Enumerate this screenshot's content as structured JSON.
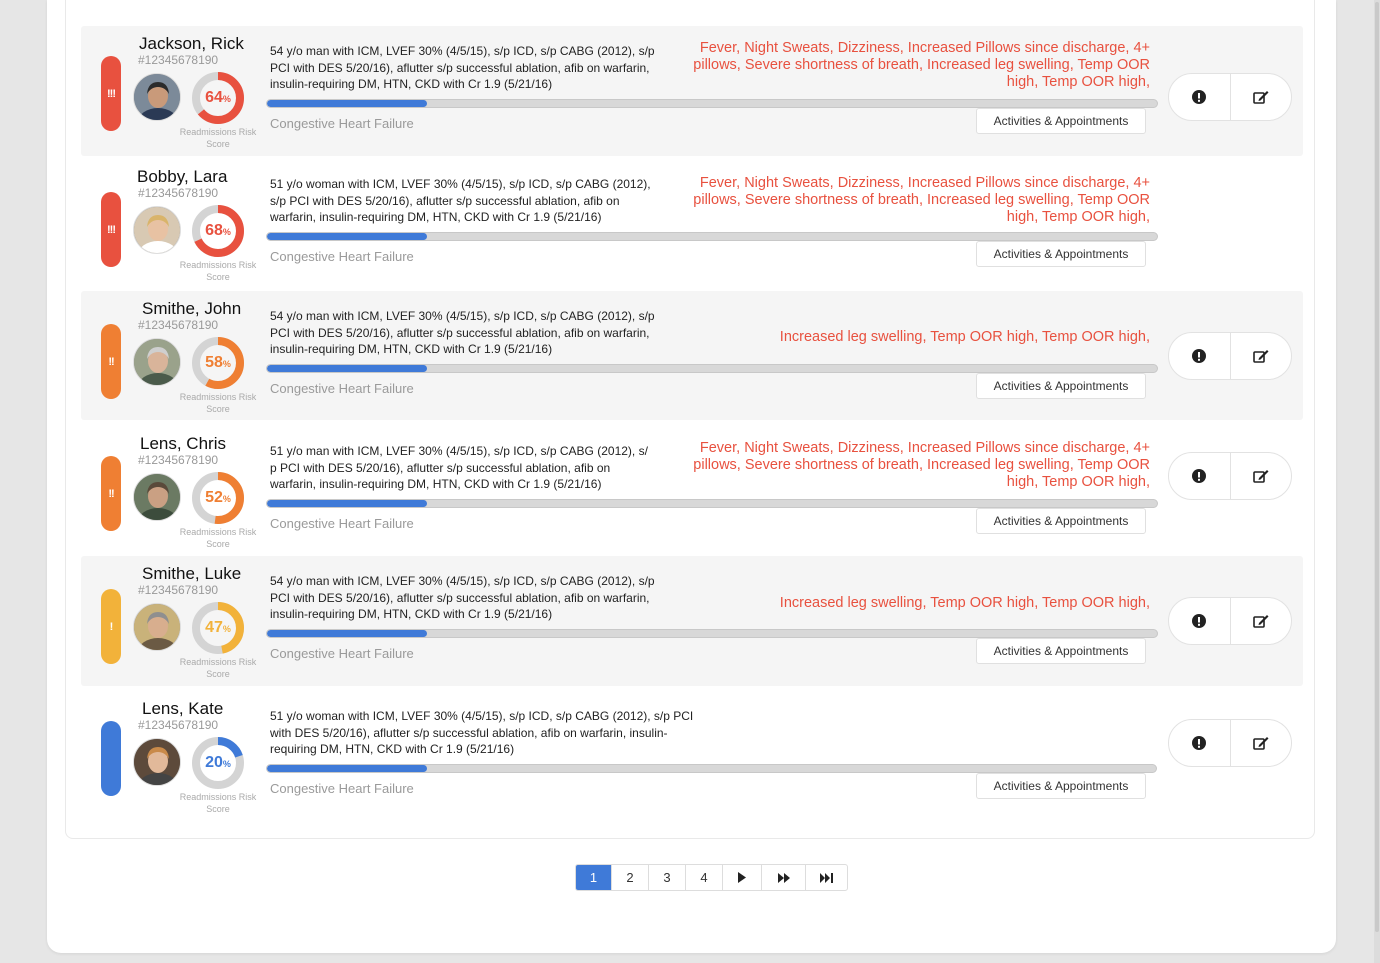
{
  "patients": [
    {
      "name": "Jackson, Rick",
      "id": "#12345678190",
      "alert_level": "!!!",
      "alert_color": "#e8513f",
      "risk_score": 64,
      "risk_color": "#e8513f",
      "risk_unit": "%",
      "risk_caption_line1": "Readmissions Risk",
      "risk_caption_line2": "Score",
      "description_lines": [
        "54 y/o man with ICM, LVEF 30% (4/5/15), s/p ICD, s/p CABG (2012), s/p",
        "PCI with DES 5/20/16), aflutter s/p successful ablation, afib on warfarin,",
        "insulin-requiring DM, HTN, CKD with Cr 1.9 (5/21/16)"
      ],
      "alert_lines": [
        "Fever, Night Sweats, Dizziness, Increased  Pillows since discharge, 4+",
        "pillows, Severe shortness of breath,  Increased leg swelling,  Temp OOR",
        "high, Temp OOR high,"
      ],
      "progress": 0.18,
      "diagnosis": "Congestive Heart Failure",
      "activities_label": "Activities & Appointments",
      "avatar_icon": "person-photo"
    },
    {
      "name": "Bobby, Lara",
      "id": "#12345678190",
      "alert_level": "!!!",
      "alert_color": "#e8513f",
      "risk_score": 68,
      "risk_color": "#e8513f",
      "risk_unit": "%",
      "risk_caption_line1": "Readmissions Risk",
      "risk_caption_line2": "Score",
      "description_lines": [
        "51 y/o woman  with ICM, LVEF 30% (4/5/15), s/p ICD, s/p CABG (2012),",
        "s/p PCI with DES 5/20/16), aflutter s/p successful ablation, afib on",
        "warfarin, insulin-requiring DM, HTN, CKD with Cr 1.9 (5/21/16)"
      ],
      "alert_lines": [
        "Fever, Night Sweats, Dizziness, Increased  Pillows since discharge, 4+",
        "pillows, Severe shortness of breath,  Increased leg swelling,  Temp OOR",
        "high, Temp OOR high,"
      ],
      "progress": 0.18,
      "diagnosis": "Congestive Heart Failure",
      "activities_label": "Activities & Appointments",
      "avatar_icon": "person-photo"
    },
    {
      "name": "Smithe, John",
      "id": "#12345678190",
      "alert_level": "!!",
      "alert_color": "#ef7f33",
      "risk_score": 58,
      "risk_color": "#ef7f33",
      "risk_unit": "%",
      "risk_caption_line1": "Readmissions Risk",
      "risk_caption_line2": "Score",
      "description_lines": [
        "54 y/o man with ICM, LVEF 30% (4/5/15), s/p ICD, s/p CABG (2012), s/p",
        "PCI with DES 5/20/16), aflutter s/p successful ablation, afib on warfarin,",
        "insulin-requiring DM, HTN, CKD with Cr 1.9 (5/21/16)"
      ],
      "alert_lines": [
        "Increased leg swelling,  Temp OOR high, Temp OOR high,"
      ],
      "progress": 0.18,
      "diagnosis": "Congestive Heart Failure",
      "activities_label": "Activities & Appointments",
      "avatar_icon": "person-photo"
    },
    {
      "name": "Lens, Chris",
      "id": "#12345678190",
      "alert_level": "!!",
      "alert_color": "#ef7f33",
      "risk_score": 52,
      "risk_color": "#ef7f33",
      "risk_unit": "%",
      "risk_caption_line1": "Readmissions Risk",
      "risk_caption_line2": "Score",
      "description_lines": [
        "51 y/o man  with ICM, LVEF 30% (4/5/15), s/p ICD, s/p CABG (2012), s/",
        "p PCI with DES 5/20/16), aflutter s/p successful ablation, afib on",
        "warfarin, insulin-requiring DM, HTN, CKD with Cr 1.9 (5/21/16)"
      ],
      "alert_lines": [
        "Fever, Night Sweats, Dizziness, Increased  Pillows since discharge, 4+",
        "pillows, Severe shortness of breath,  Increased leg swelling,  Temp OOR",
        "high, Temp OOR high,"
      ],
      "progress": 0.18,
      "diagnosis": "Congestive Heart Failure",
      "activities_label": "Activities & Appointments",
      "avatar_icon": "person-photo"
    },
    {
      "name": "Smithe, Luke",
      "id": "#12345678190",
      "alert_level": "!",
      "alert_color": "#f2b23a",
      "risk_score": 47,
      "risk_color": "#f2b23a",
      "risk_unit": "%",
      "risk_caption_line1": "Readmissions Risk",
      "risk_caption_line2": "Score",
      "description_lines": [
        "54 y/o man with ICM, LVEF 30% (4/5/15), s/p ICD, s/p CABG (2012), s/p",
        "PCI with DES 5/20/16), aflutter s/p successful ablation, afib on warfarin,",
        "insulin-requiring DM, HTN, CKD with Cr 1.9 (5/21/16)"
      ],
      "alert_lines": [
        "Increased leg swelling,  Temp OOR high, Temp OOR high,"
      ],
      "progress": 0.18,
      "diagnosis": "Congestive Heart Failure",
      "activities_label": "Activities & Appointments",
      "avatar_icon": "person-photo"
    },
    {
      "name": "Lens, Kate",
      "id": "#12345678190",
      "alert_level": "",
      "alert_color": "#3f7ad8",
      "risk_score": 20,
      "risk_color": "#3f7ad8",
      "risk_unit": "%",
      "risk_caption_line1": "Readmissions Risk",
      "risk_caption_line2": "Score",
      "description_lines": [
        "51 y/o woman  with ICM, LVEF 30% (4/5/15), s/p ICD, s/p CABG (2012), s/p PCI",
        "with DES 5/20/16), aflutter s/p successful ablation, afib on warfarin, insulin-",
        "requiring DM, HTN, CKD with Cr 1.9 (5/21/16)"
      ],
      "alert_lines": [],
      "progress": 0.18,
      "diagnosis": "Congestive Heart Failure",
      "activities_label": "Activities & Appointments",
      "avatar_icon": "person-photo"
    }
  ],
  "pagination": {
    "pages": [
      "1",
      "2",
      "3",
      "4"
    ],
    "active": "1",
    "next_icon": "next-icon",
    "fast_forward_icon": "fast-forward-icon",
    "last_icon": "last-page-icon"
  },
  "action_icons": {
    "alert": "exclamation-circle-icon",
    "edit": "edit-icon"
  },
  "colors": {
    "accent": "#3f7ad8",
    "alert_text": "#e8513f",
    "gauge_track": "#d4d4d4"
  }
}
